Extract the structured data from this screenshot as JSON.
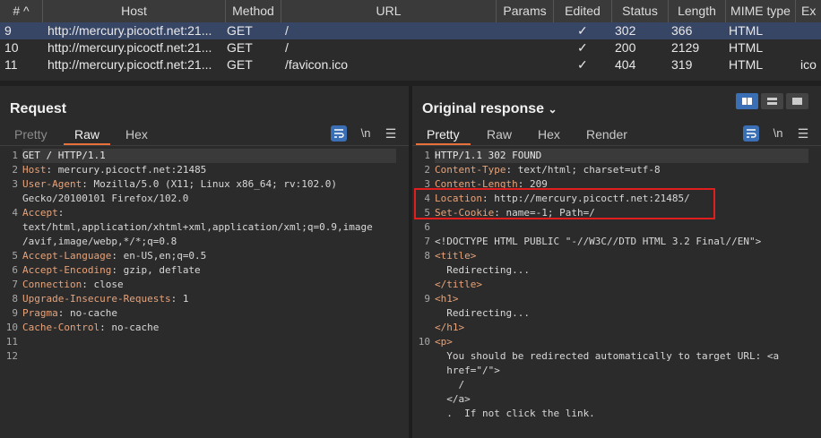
{
  "table": {
    "columns": [
      "#",
      "Host",
      "Method",
      "URL",
      "Params",
      "Edited",
      "Status",
      "Length",
      "MIME type",
      "Ex"
    ],
    "sort_indicator": "^",
    "rows": [
      {
        "num": "9",
        "host": "http://mercury.picoctf.net:21...",
        "method": "GET",
        "url": "/",
        "params": "",
        "edited": "✓",
        "status": "302",
        "length": "366",
        "mime": "HTML",
        "ext": ""
      },
      {
        "num": "10",
        "host": "http://mercury.picoctf.net:21...",
        "method": "GET",
        "url": "/",
        "params": "",
        "edited": "✓",
        "status": "200",
        "length": "2129",
        "mime": "HTML",
        "ext": ""
      },
      {
        "num": "11",
        "host": "http://mercury.picoctf.net:21...",
        "method": "GET",
        "url": "/favicon.ico",
        "params": "",
        "edited": "✓",
        "status": "404",
        "length": "319",
        "mime": "HTML",
        "ext": "ico"
      }
    ]
  },
  "request": {
    "title": "Request",
    "tabs": [
      "Pretty",
      "Raw",
      "Hex"
    ],
    "wrap_label": "\\n",
    "lines": [
      {
        "n": "1",
        "key": "GET / HTTP/1.1",
        "val": ""
      },
      {
        "n": "2",
        "key": "Host",
        "val": ": mercury.picoctf.net:21485"
      },
      {
        "n": "3",
        "key": "User-Agent",
        "val": ": Mozilla/5.0 (X11; Linux x86_64; rv:102.0)"
      },
      {
        "n": "",
        "key": "",
        "val": "Gecko/20100101 Firefox/102.0"
      },
      {
        "n": "4",
        "key": "Accept",
        "val": ":"
      },
      {
        "n": "",
        "key": "",
        "val": "text/html,application/xhtml+xml,application/xml;q=0.9,image"
      },
      {
        "n": "",
        "key": "",
        "val": "/avif,image/webp,*/*;q=0.8"
      },
      {
        "n": "5",
        "key": "Accept-Language",
        "val": ": en-US,en;q=0.5"
      },
      {
        "n": "6",
        "key": "Accept-Encoding",
        "val": ": gzip, deflate"
      },
      {
        "n": "7",
        "key": "Connection",
        "val": ": close"
      },
      {
        "n": "8",
        "key": "Upgrade-Insecure-Requests",
        "val": ": 1"
      },
      {
        "n": "9",
        "key": "Pragma",
        "val": ": no-cache"
      },
      {
        "n": "10",
        "key": "Cache-Control",
        "val": ": no-cache"
      },
      {
        "n": "11",
        "key": "",
        "val": ""
      },
      {
        "n": "12",
        "key": "",
        "val": ""
      }
    ]
  },
  "response": {
    "title": "Original response",
    "tabs": [
      "Pretty",
      "Raw",
      "Hex",
      "Render"
    ],
    "wrap_label": "\\n",
    "lines": [
      {
        "n": "1",
        "key": "HTTP/1.1 302 FOUND",
        "val": ""
      },
      {
        "n": "2",
        "key": "Content-Type",
        "val": ": text/html; charset=utf-8"
      },
      {
        "n": "3",
        "key": "Content-Length",
        "val": ": 209"
      },
      {
        "n": "4",
        "key": "Location",
        "val": ": http://mercury.picoctf.net:21485/"
      },
      {
        "n": "5",
        "key": "Set-Cookie",
        "val": ": name=-1; Path=/"
      },
      {
        "n": "6",
        "key": "",
        "val": ""
      },
      {
        "n": "7",
        "key": "",
        "val": "<!DOCTYPE HTML PUBLIC \"-//W3C//DTD HTML 3.2 Final//EN\">"
      },
      {
        "n": "8",
        "key": "",
        "val": "<title>",
        "tag": true
      },
      {
        "n": "",
        "key": "",
        "val": "  Redirecting..."
      },
      {
        "n": "",
        "key": "",
        "val": "</title>",
        "tag": true
      },
      {
        "n": "9",
        "key": "",
        "val": "<h1>",
        "tag": true
      },
      {
        "n": "",
        "key": "",
        "val": "  Redirecting..."
      },
      {
        "n": "",
        "key": "",
        "val": "</h1>",
        "tag": true
      },
      {
        "n": "10",
        "key": "",
        "val": "<p>",
        "tag": true
      },
      {
        "n": "",
        "key": "",
        "val": "  You should be redirected automatically to target URL: <a"
      },
      {
        "n": "",
        "key": "",
        "val": "  href=\"/\">"
      },
      {
        "n": "",
        "key": "",
        "val": "    /"
      },
      {
        "n": "",
        "key": "",
        "val": "  </a>"
      },
      {
        "n": "",
        "key": "",
        "val": "  .  If not click the link."
      }
    ]
  },
  "colors": {
    "accent": "#e8703a",
    "selected_row": "#384666",
    "highlight_box": "#e01e1e",
    "button_blue": "#3a6fb5"
  }
}
